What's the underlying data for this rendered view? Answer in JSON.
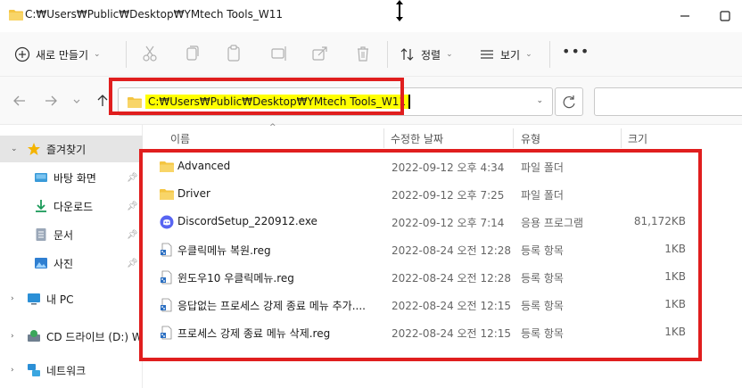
{
  "window": {
    "title": "C:₩Users₩Public₩Desktop₩YMtech Tools_W11",
    "icons": {
      "folder": "folder-icon",
      "minimize": "minimize-icon",
      "maximize": "maximize-icon",
      "cursor": "resize-cursor-icon"
    }
  },
  "toolbar": {
    "new_label": "새로 만들기",
    "sort_label": "정렬",
    "view_label": "보기",
    "more_label": "•••",
    "icons": [
      "cut-icon",
      "copy-icon",
      "paste-icon",
      "rename-icon",
      "share-icon",
      "delete-icon"
    ]
  },
  "address": {
    "path": "C:₩Users₩Public₩Desktop₩YMtech Tools_W11",
    "highlight_color": "#ffff00"
  },
  "sidebar": {
    "items": [
      {
        "label": "즐겨찾기",
        "icon": "star-icon",
        "selected": true
      },
      {
        "label": "바탕 화면",
        "icon": "desktop-icon"
      },
      {
        "label": "다운로드",
        "icon": "download-icon"
      },
      {
        "label": "문서",
        "icon": "document-icon"
      },
      {
        "label": "사진",
        "icon": "pictures-icon"
      },
      {
        "label": "내 PC",
        "icon": "pc-icon"
      },
      {
        "label": "CD 드라이브 (D:) W",
        "icon": "cd-drive-icon"
      },
      {
        "label": "네트워크",
        "icon": "network-icon"
      }
    ]
  },
  "columns": [
    "이름",
    "수정한 날짜",
    "유형",
    "크기"
  ],
  "files": [
    {
      "name": "Advanced",
      "date": "2022-09-12 오후 4:34",
      "type": "파일 폴더",
      "size": "",
      "icon": "folder-icon"
    },
    {
      "name": "Driver",
      "date": "2022-09-12 오후 7:25",
      "type": "파일 폴더",
      "size": "",
      "icon": "folder-icon"
    },
    {
      "name": "DiscordSetup_220912.exe",
      "date": "2022-09-12 오후 7:14",
      "type": "응용 프로그램",
      "size": "81,172KB",
      "icon": "discord-icon"
    },
    {
      "name": "우클릭메뉴 복원.reg",
      "date": "2022-08-24 오전 12:28",
      "type": "등록 항목",
      "size": "1KB",
      "icon": "reg-file-icon"
    },
    {
      "name": "윈도우10 우클릭메뉴.reg",
      "date": "2022-08-24 오전 12:28",
      "type": "등록 항목",
      "size": "1KB",
      "icon": "reg-file-icon"
    },
    {
      "name": "응답없는 프로세스 강제 종료 메뉴 추가....",
      "date": "2022-08-24 오전 12:15",
      "type": "등록 항목",
      "size": "1KB",
      "icon": "reg-file-icon"
    },
    {
      "name": "프로세스 강제 종료 메뉴 삭제.reg",
      "date": "2022-08-24 오전 12:15",
      "type": "등록 항목",
      "size": "1KB",
      "icon": "reg-file-icon"
    }
  ],
  "colors": {
    "annotation_red": "#e01e1e",
    "folder_yellow": "#f4c542",
    "discord_blue": "#5865f2"
  }
}
